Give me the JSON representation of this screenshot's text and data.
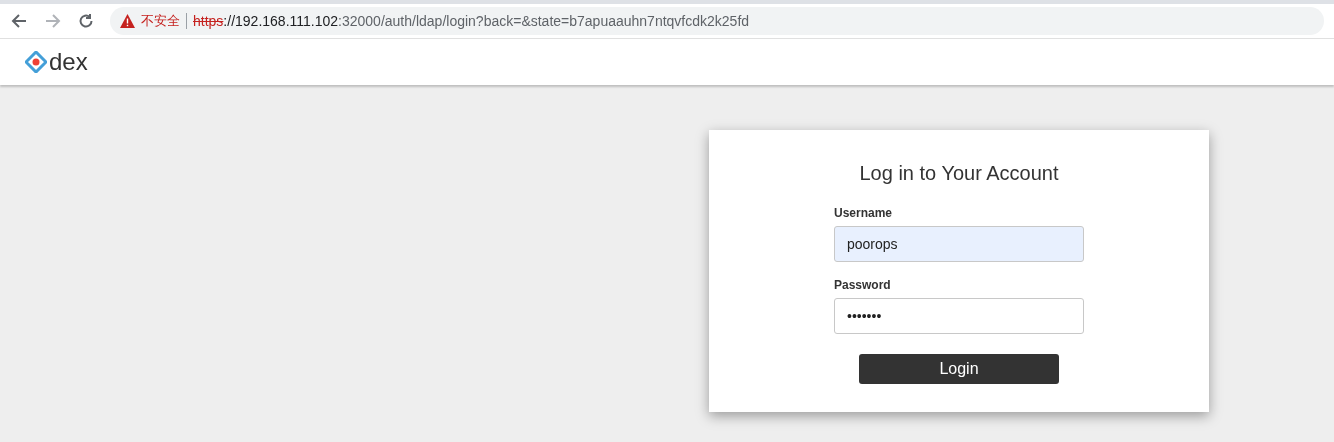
{
  "browser": {
    "security_label": "不安全",
    "url_scheme": "https",
    "url_host": "://192.168.111.102",
    "url_rest": ":32000/auth/ldap/login?back=&state=b7apuaauhn7ntqvfcdk2k25fd"
  },
  "header": {
    "logo_text": "dex"
  },
  "login": {
    "title": "Log in to Your Account",
    "fields": [
      {
        "label": "Username",
        "value": "poorops",
        "autofilled": true
      },
      {
        "label": "Password",
        "value": "•••••••",
        "autofilled": false
      }
    ],
    "button": "Login"
  }
}
